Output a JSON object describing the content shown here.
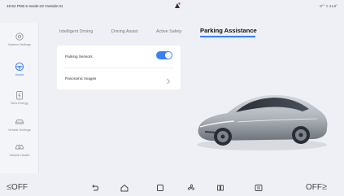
{
  "status_bar": {
    "left_text": "16:54 PM2.5 Inside:22 Outside:31",
    "right_text": "8°° ≡ 4∧0°"
  },
  "sidebar": {
    "items": [
      {
        "label": "System Settings",
        "icon": "gear-icon",
        "active": false
      },
      {
        "label": "Assist",
        "icon": "steering-wheel-icon",
        "active": true
      },
      {
        "label": "New Energy",
        "icon": "battery-icon",
        "active": false
      },
      {
        "label": "Vehicle Settings",
        "icon": "car-icon",
        "active": false
      },
      {
        "label": "Vehicle Health",
        "icon": "car-check-icon",
        "active": false
      }
    ]
  },
  "tabs": [
    {
      "label": "Intelligent Driving",
      "active": false
    },
    {
      "label": "Driving Assist",
      "active": false
    },
    {
      "label": "Active Safety",
      "active": false
    },
    {
      "label": "Parking Assistance",
      "active": true
    }
  ],
  "settings": {
    "parking_sensors_label": "Parking Sensors",
    "parking_sensors_on": true,
    "panoramic_images_label": "Panoramic Images"
  },
  "bottom_bar": {
    "left_label": "OFF",
    "right_label": "OFF",
    "icons": [
      "back-icon",
      "home-icon",
      "recent-apps-icon",
      "fan-icon",
      "seat-heat-icon",
      "defrost-icon"
    ]
  },
  "colors": {
    "accent": "#3d7ff5",
    "background": "#eef0f5",
    "card": "#ffffff"
  }
}
